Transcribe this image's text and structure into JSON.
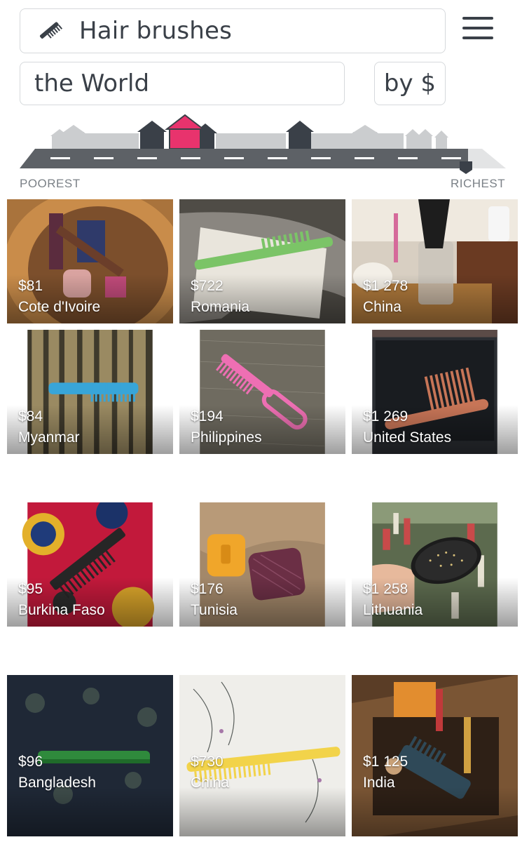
{
  "topic": {
    "label": "Hair brushes",
    "icon": "comb-icon"
  },
  "place": {
    "label": "the World"
  },
  "sort": {
    "label": "by $"
  },
  "street": {
    "poorest_label": "POOREST",
    "richest_label": "RICHEST"
  },
  "colors": {
    "text": "#3a4048",
    "highlight_house": "#e8336d",
    "house_dark": "#3a4048",
    "house_light": "#c9cbcd",
    "road": "#5d6166"
  },
  "homes": [
    {
      "income": "$81",
      "country": "Cote d'Ivoire",
      "scene": "basket with comb and bottles"
    },
    {
      "income": "$722",
      "country": "Romania",
      "scene": "green comb on plate"
    },
    {
      "income": "$1 278",
      "country": "China",
      "scene": "brush in glass on counter"
    },
    {
      "income": "$84",
      "country": "Myanmar",
      "scene": "blue comb on bamboo"
    },
    {
      "income": "$194",
      "country": "Philippines",
      "scene": "pink comb on fabric"
    },
    {
      "income": "$1 269",
      "country": "United States",
      "scene": "orange pick comb on black"
    },
    {
      "income": "$95",
      "country": "Burkina Faso",
      "scene": "black comb on wax print"
    },
    {
      "income": "$176",
      "country": "Tunisia",
      "scene": "yellow and purple brushes"
    },
    {
      "income": "$1 258",
      "country": "Lithuania",
      "scene": "paddle brush in hand"
    },
    {
      "income": "$96",
      "country": "Bangladesh",
      "scene": "green comb on dark fabric"
    },
    {
      "income": "$730",
      "country": "China",
      "scene": "yellow comb on white"
    },
    {
      "income": "$1 125",
      "country": "India",
      "scene": "comb in wooden box"
    }
  ]
}
